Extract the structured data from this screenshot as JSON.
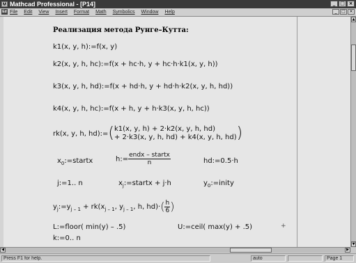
{
  "window": {
    "title": "Mathcad Professional - [P14]",
    "buttons": {
      "minimize": "_",
      "maximize": "□",
      "close": "×"
    }
  },
  "menubar": {
    "doc_icon_label": "Ed",
    "items": [
      "File",
      "Edit",
      "View",
      "Insert",
      "Format",
      "Math",
      "Symbolics",
      "Window",
      "Help"
    ],
    "doc_buttons": {
      "minimize": "_",
      "restore": "□",
      "close": "×"
    }
  },
  "document": {
    "heading": "Реализация метода Рунге–Кутта:",
    "k1": "k1(x, y, h):=f(x, y)",
    "k2": "k2(x, y, h, hc):=f(x + hc·h, y + hc·h·k1(x, y, h))",
    "k3": "k3(x, y, h, hd):=f(x + hd·h, y + hd·h·k2(x, y, h, hd))",
    "k4": "k4(x, y, h, hc):=f(x + h, y + h·k3(x, y, h, hc))",
    "rk_lhs": "rk(x, y, h, hd):=",
    "rk_line1": "k1(x, y, h) + 2·k2(x, y, h, hd)",
    "rk_line2": "+ 2·k3(x, y, h, hd) + k4(x, y, h, hd)",
    "x0_lhs": "x",
    "x0_sub": "0",
    "x0_rhs": ":=startx",
    "h_lhs": "h:=",
    "h_num": "endx – startx",
    "h_den": "n",
    "hd_def": "hd:=0.5·h",
    "j_range": "j:=1.. n",
    "xj_lhs": "x",
    "xj_sub": "j",
    "xj_rhs": ":=startx + j·h",
    "y0_lhs": "y",
    "y0_sub": "0",
    "y0_rhs": ":=inity",
    "yj_lhs": "y",
    "yj_sub": "j",
    "yj_mid": ":=y",
    "yj_sub2": "j – 1",
    "yj_rk": " + rk(x",
    "yj_sub3": "j – 1",
    "yj_comma": ", y",
    "yj_sub4": "j – 1",
    "yj_tail": ", h, hd)·",
    "yj_frac_num": "h",
    "yj_frac_den": "6",
    "L_def": "L:=floor( min(y) – .5)",
    "U_def": "U:=ceil( max(y) + .5)",
    "k_range": "k:=0.. n"
  },
  "statusbar": {
    "help_text": "Press F1 for help.",
    "mode": "auto",
    "page": "Page 1"
  }
}
